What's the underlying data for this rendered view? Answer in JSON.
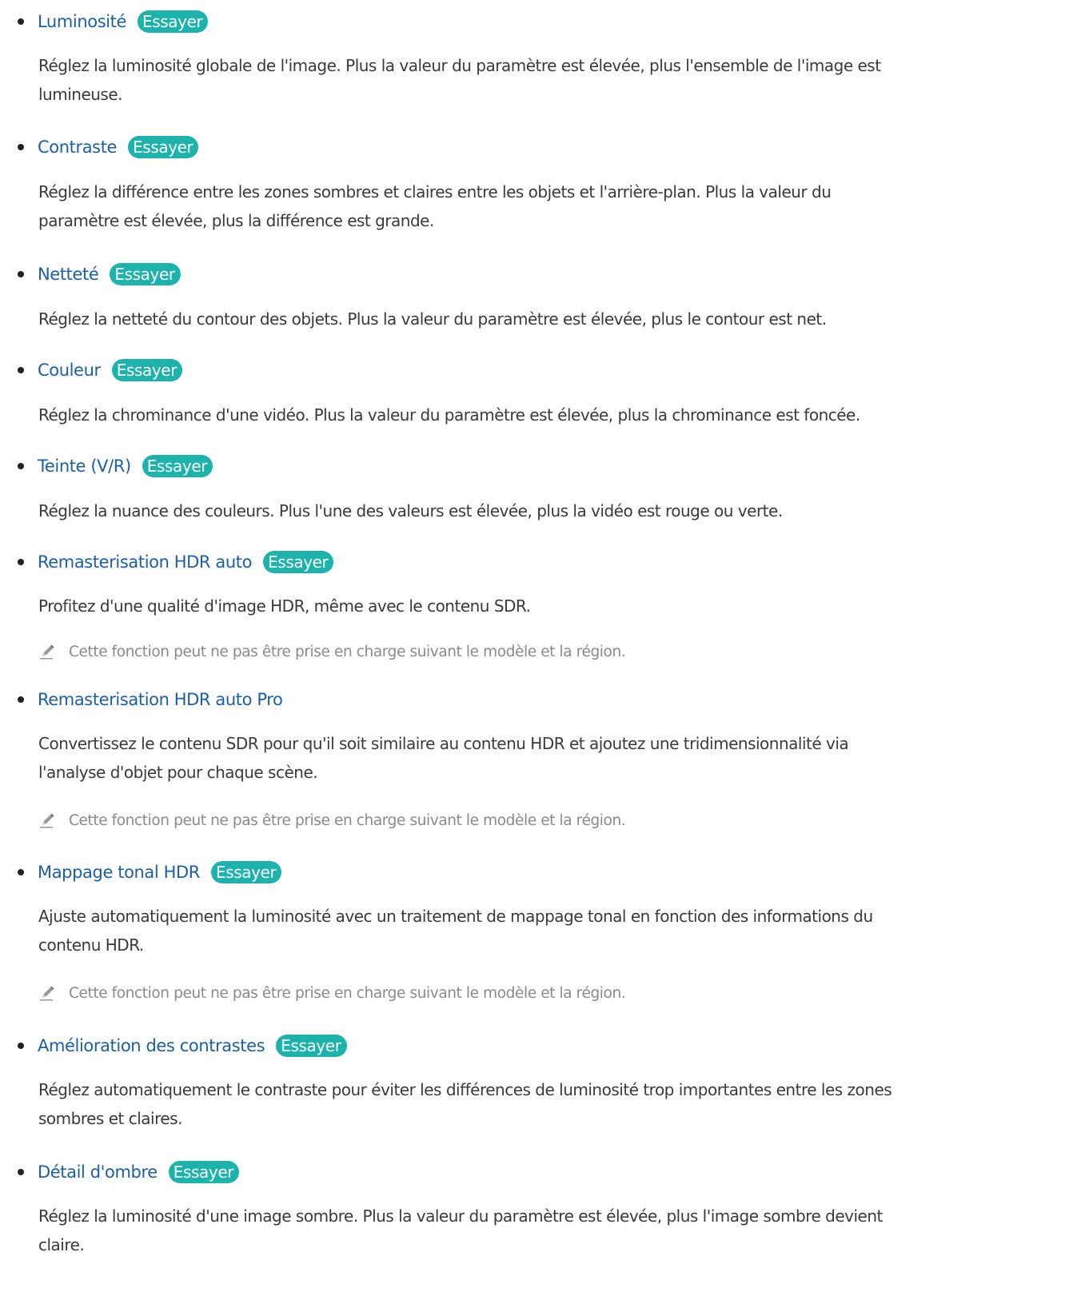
{
  "badge_label": "Essayer",
  "colors": {
    "title": "#1a5fa8",
    "badge": "#1db3ad",
    "body_text": "#3a3a3a",
    "note_text": "#8a8a8a"
  },
  "items": [
    {
      "title": "Luminosité",
      "has_badge": true,
      "desc_lines": [
        "Réglez la luminosité globale de l'image. Plus la valeur du paramètre est élevée, plus l'ensemble de l'image est",
        "lumineuse."
      ],
      "note": ""
    },
    {
      "title": "Contraste",
      "has_badge": true,
      "desc_lines": [
        "Réglez la différence entre les zones sombres et claires entre les objets et l'arrière-plan. Plus la valeur du",
        "paramètre est élevée, plus la différence est grande."
      ],
      "note": ""
    },
    {
      "title": "Netteté",
      "has_badge": true,
      "desc_lines": [
        "Réglez la netteté du contour des objets. Plus la valeur du paramètre est élevée, plus le contour est net."
      ],
      "note": ""
    },
    {
      "title": "Couleur",
      "has_badge": true,
      "desc_lines": [
        "Réglez la chrominance d'une vidéo. Plus la valeur du paramètre est élevée, plus la chrominance est foncée."
      ],
      "note": ""
    },
    {
      "title": "Teinte (V/R)",
      "has_badge": true,
      "desc_lines": [
        "Réglez la nuance des couleurs. Plus l'une des valeurs est élevée, plus la vidéo est rouge ou verte."
      ],
      "note": ""
    },
    {
      "title": "Remasterisation HDR auto",
      "has_badge": true,
      "desc_lines": [
        "Profitez d'une qualité d'image HDR, même avec le contenu SDR."
      ],
      "note": "Cette fonction peut ne pas être prise en charge suivant le modèle et la région."
    },
    {
      "title": "Remasterisation HDR auto Pro",
      "has_badge": false,
      "desc_lines": [
        "Convertissez le contenu SDR pour qu'il soit similaire au contenu HDR et ajoutez une tridimensionnalité via",
        "l'analyse d'objet pour chaque scène."
      ],
      "note": "Cette fonction peut ne pas être prise en charge suivant le modèle et la région."
    },
    {
      "title": "Mappage tonal HDR",
      "has_badge": true,
      "desc_lines": [
        "Ajuste automatiquement la luminosité avec un traitement de mappage tonal en fonction des informations du",
        "contenu HDR."
      ],
      "note": "Cette fonction peut ne pas être prise en charge suivant le modèle et la région."
    },
    {
      "title": "Amélioration des contrastes",
      "has_badge": true,
      "desc_lines": [
        "Réglez automatiquement le contraste pour éviter les différences de luminosité trop importantes entre les zones",
        "sombres et claires."
      ],
      "note": ""
    },
    {
      "title": "Détail d'ombre",
      "has_badge": true,
      "desc_lines": [
        "Réglez la luminosité d'une image sombre. Plus la valeur du paramètre est élevée, plus l'image sombre devient",
        "claire."
      ],
      "note": ""
    }
  ]
}
